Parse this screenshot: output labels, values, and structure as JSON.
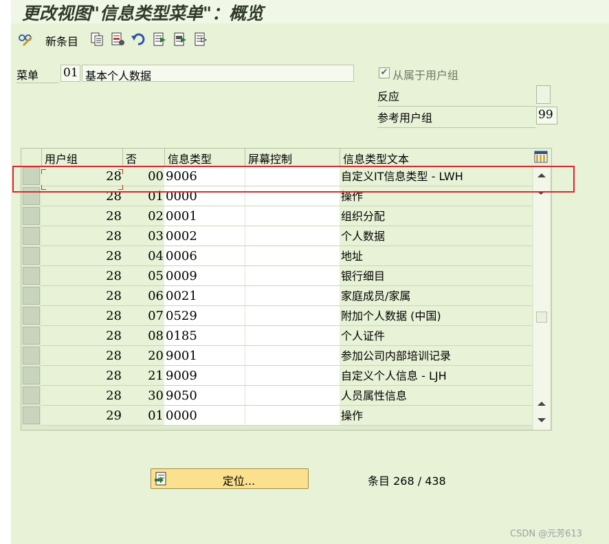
{
  "title": "更改视图\"信息类型菜单\"：概览",
  "toolbar": {
    "new_entries_label": "新条目",
    "icons": [
      "glasses-edit-icon",
      "copy-icon",
      "delete-icon",
      "undo-icon",
      "select-all-icon",
      "select-block-icon",
      "deselect-all-icon"
    ]
  },
  "header_fields": {
    "menu_label": "菜单",
    "menu_code": "01",
    "menu_desc": "基本个人数据",
    "user_group_dependent_label": "从属于用户组",
    "user_group_dependent_checked": true,
    "reaction_label": "反应",
    "ref_user_group_label": "参考用户组",
    "ref_user_group_value": "99"
  },
  "table": {
    "columns": [
      "用户组",
      "否",
      "信息类型",
      "屏幕控制",
      "信息类型文本"
    ],
    "rows": [
      {
        "group": "28",
        "no": "00",
        "infotype": "9006",
        "screen": "",
        "text": "自定义IT信息类型 - LWH"
      },
      {
        "group": "28",
        "no": "01",
        "infotype": "0000",
        "screen": "",
        "text": "操作"
      },
      {
        "group": "28",
        "no": "02",
        "infotype": "0001",
        "screen": "",
        "text": "组织分配"
      },
      {
        "group": "28",
        "no": "03",
        "infotype": "0002",
        "screen": "",
        "text": "个人数据"
      },
      {
        "group": "28",
        "no": "04",
        "infotype": "0006",
        "screen": "",
        "text": "地址"
      },
      {
        "group": "28",
        "no": "05",
        "infotype": "0009",
        "screen": "",
        "text": "银行细目"
      },
      {
        "group": "28",
        "no": "06",
        "infotype": "0021",
        "screen": "",
        "text": "家庭成员/家属"
      },
      {
        "group": "28",
        "no": "07",
        "infotype": "0529",
        "screen": "",
        "text": "附加个人数据 (中国)"
      },
      {
        "group": "28",
        "no": "08",
        "infotype": "0185",
        "screen": "",
        "text": "个人证件"
      },
      {
        "group": "28",
        "no": "20",
        "infotype": "9001",
        "screen": "",
        "text": "参加公司内部培训记录"
      },
      {
        "group": "28",
        "no": "21",
        "infotype": "9009",
        "screen": "",
        "text": "自定义个人信息 - LJH"
      },
      {
        "group": "28",
        "no": "30",
        "infotype": "9050",
        "screen": "",
        "text": "人员属性信息"
      },
      {
        "group": "29",
        "no": "01",
        "infotype": "0000",
        "screen": "",
        "text": "操作"
      }
    ]
  },
  "footer": {
    "position_button_label": "定位...",
    "entry_count": "条目 268 / 438"
  },
  "watermark": "CSDN @元芳613",
  "colors": {
    "background": "#e8f2d6",
    "highlight": "#e0242b",
    "button": "#fbe18d"
  }
}
